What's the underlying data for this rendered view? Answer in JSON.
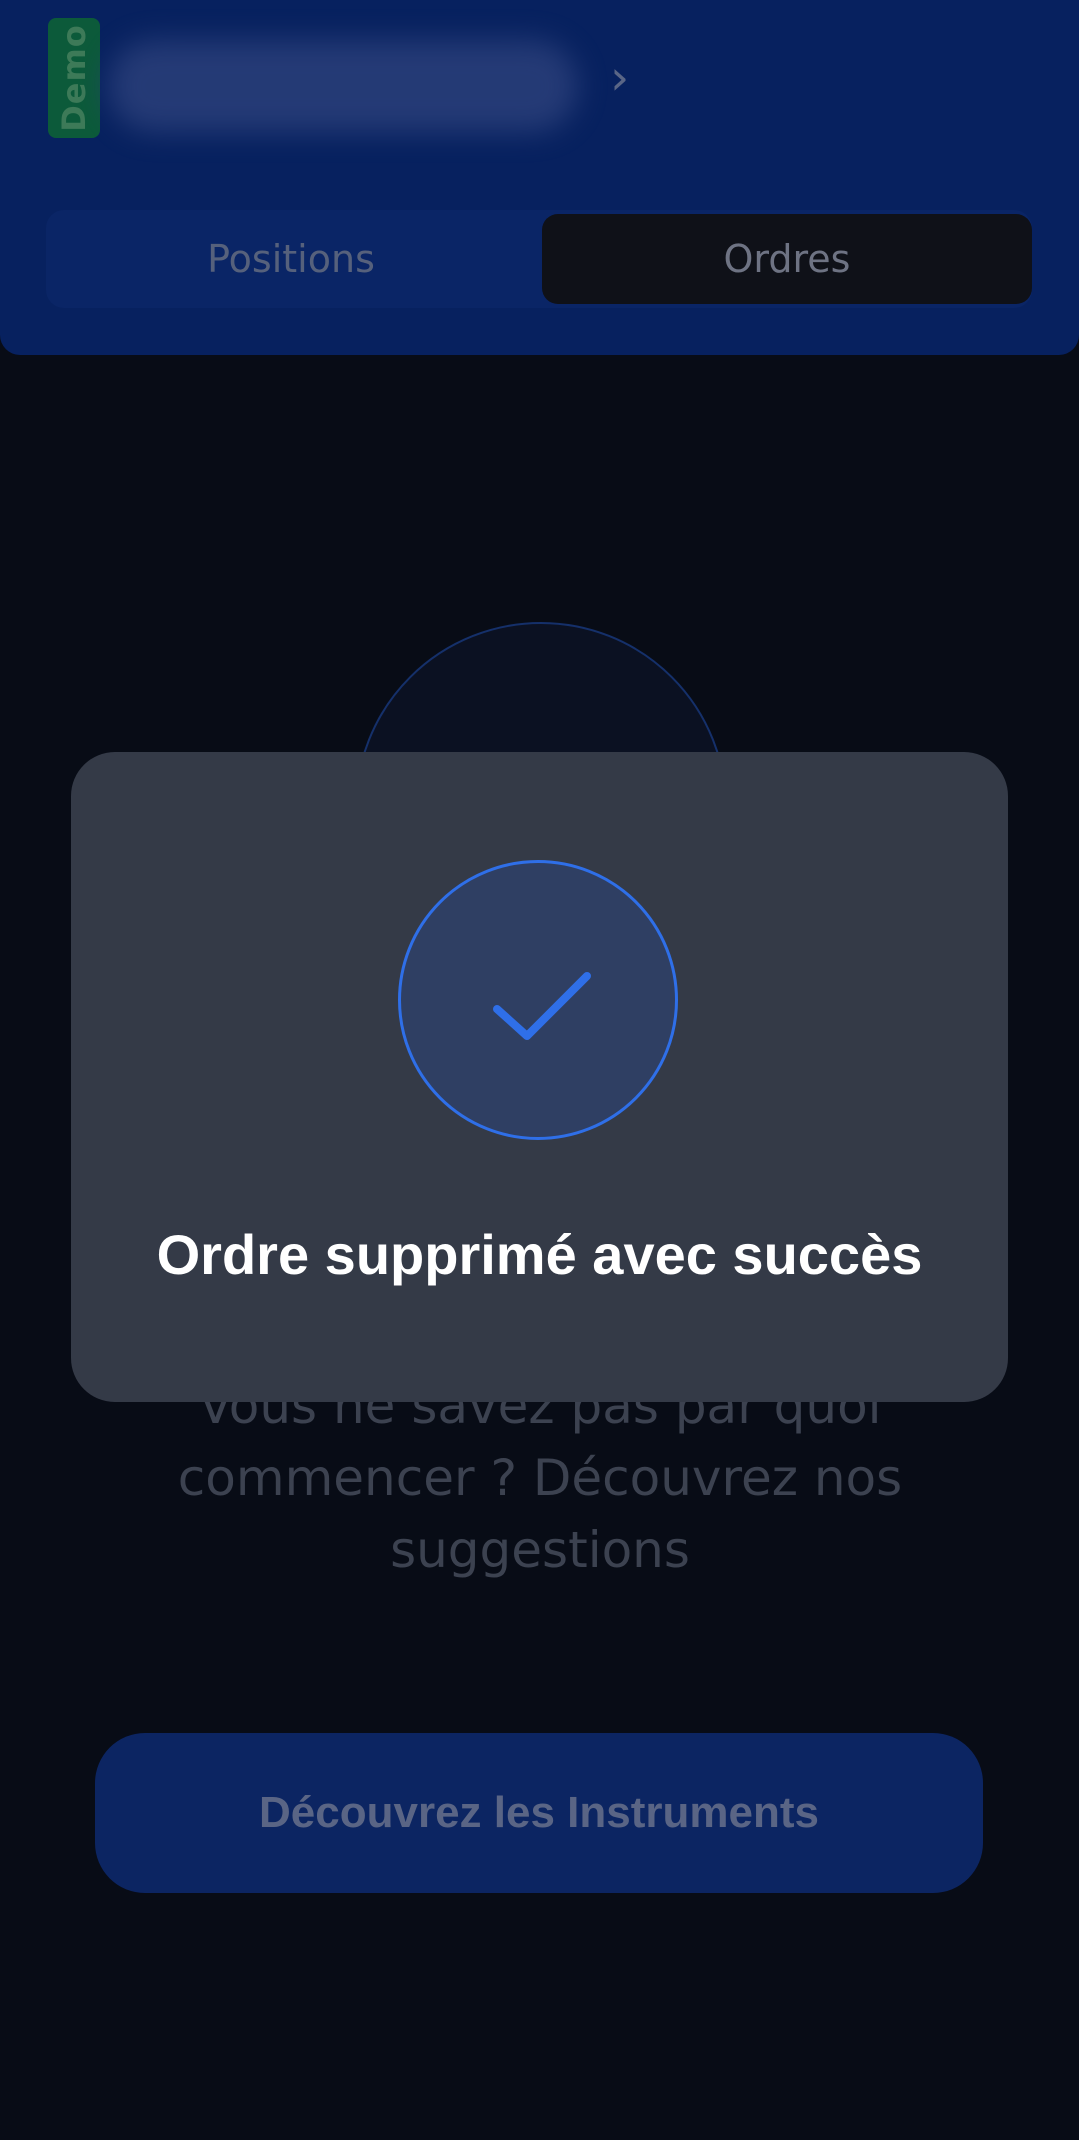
{
  "header": {
    "account_badge": "Demo",
    "balance_hidden": "",
    "tabs": [
      {
        "label": "Positions",
        "active": false
      },
      {
        "label": "Ordres",
        "active": true
      }
    ]
  },
  "empty_state": {
    "message": "Vous ne savez pas par quoi commencer ? Découvrez nos suggestions",
    "button_label": "Découvrez les Instruments"
  },
  "toast": {
    "icon": "check-icon",
    "message": "Ordre supprimé avec succès"
  },
  "colors": {
    "header_bg": "#07215f",
    "page_bg": "#080c16",
    "toast_bg": "#343a47",
    "accent": "#2f6fe8",
    "demo_badge": "#0c5a3a"
  }
}
